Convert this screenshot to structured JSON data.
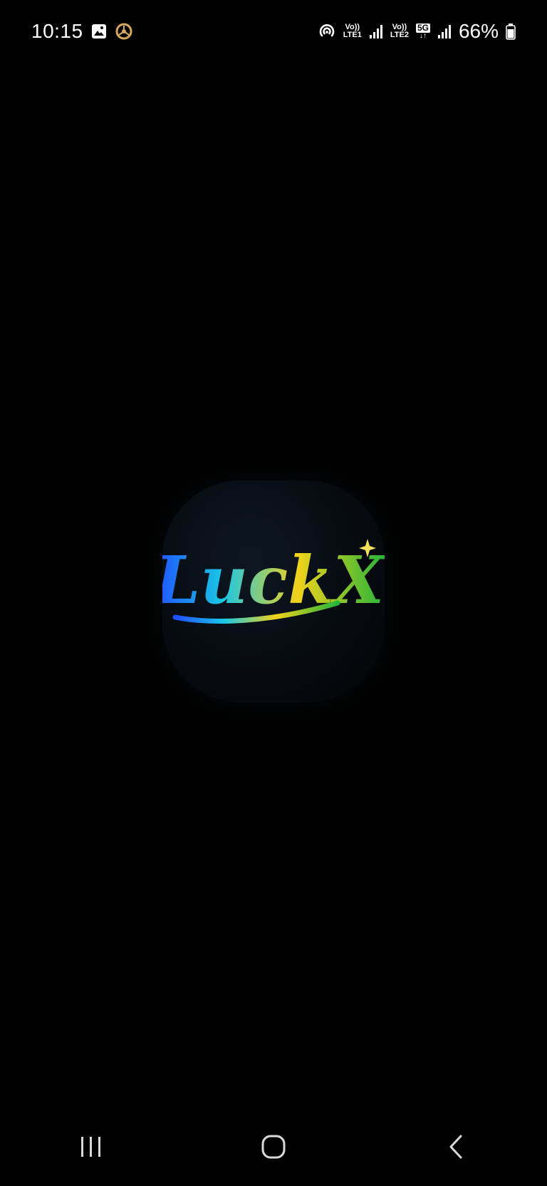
{
  "status_bar": {
    "time": "10:15",
    "sim1_top": "Vo))",
    "sim1_bottom": "LTE1",
    "sim2_top": "Vo))",
    "sim2_bottom": "LTE2",
    "network_type": "5G",
    "network_arrows": "↓↑",
    "battery_percent": "66%",
    "left_icons": [
      "gallery-icon",
      "ring-app-icon"
    ],
    "right_icons": [
      "hotspot-icon",
      "signal-icon",
      "signal-icon",
      "battery-icon"
    ]
  },
  "splash": {
    "logo_text": "LuckX",
    "logo_icon": "sparkle-icon"
  },
  "nav_bar": {
    "items": [
      "recent-apps-icon",
      "home-icon",
      "back-icon"
    ]
  },
  "colors": {
    "background": "#000000",
    "foreground": "#ffffff",
    "ring_icon": "#d6a95a",
    "logo_blue": "#1f4dff",
    "logo_cyan": "#19c7e6",
    "logo_yellow": "#f2d21b",
    "logo_green": "#22b53a",
    "sparkle": "#f5e05a"
  }
}
